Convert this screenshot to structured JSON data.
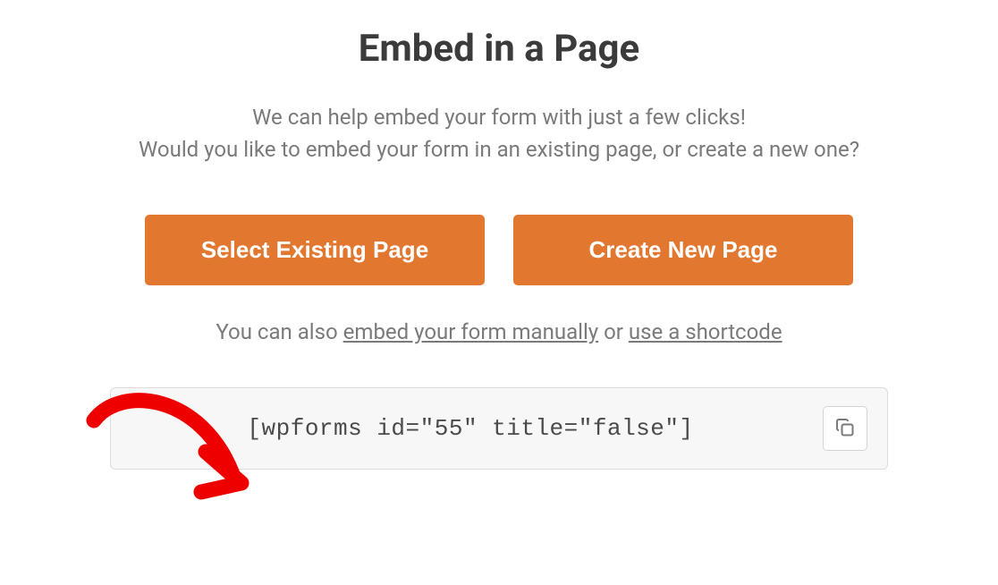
{
  "title": "Embed in a Page",
  "subtitle_line1": "We can help embed your form with just a few clicks!",
  "subtitle_line2": "Would you like to embed your form in an existing page, or create a new one?",
  "buttons": {
    "select_existing": "Select Existing Page",
    "create_new": "Create New Page"
  },
  "alt_text": {
    "prefix": "You can also ",
    "link_manual": "embed your form manually",
    "middle": " or ",
    "link_shortcode": "use a shortcode"
  },
  "shortcode": "[wpforms id=\"55\" title=\"false\"]",
  "colors": {
    "accent": "#e27730",
    "annotation": "#ee0000"
  }
}
